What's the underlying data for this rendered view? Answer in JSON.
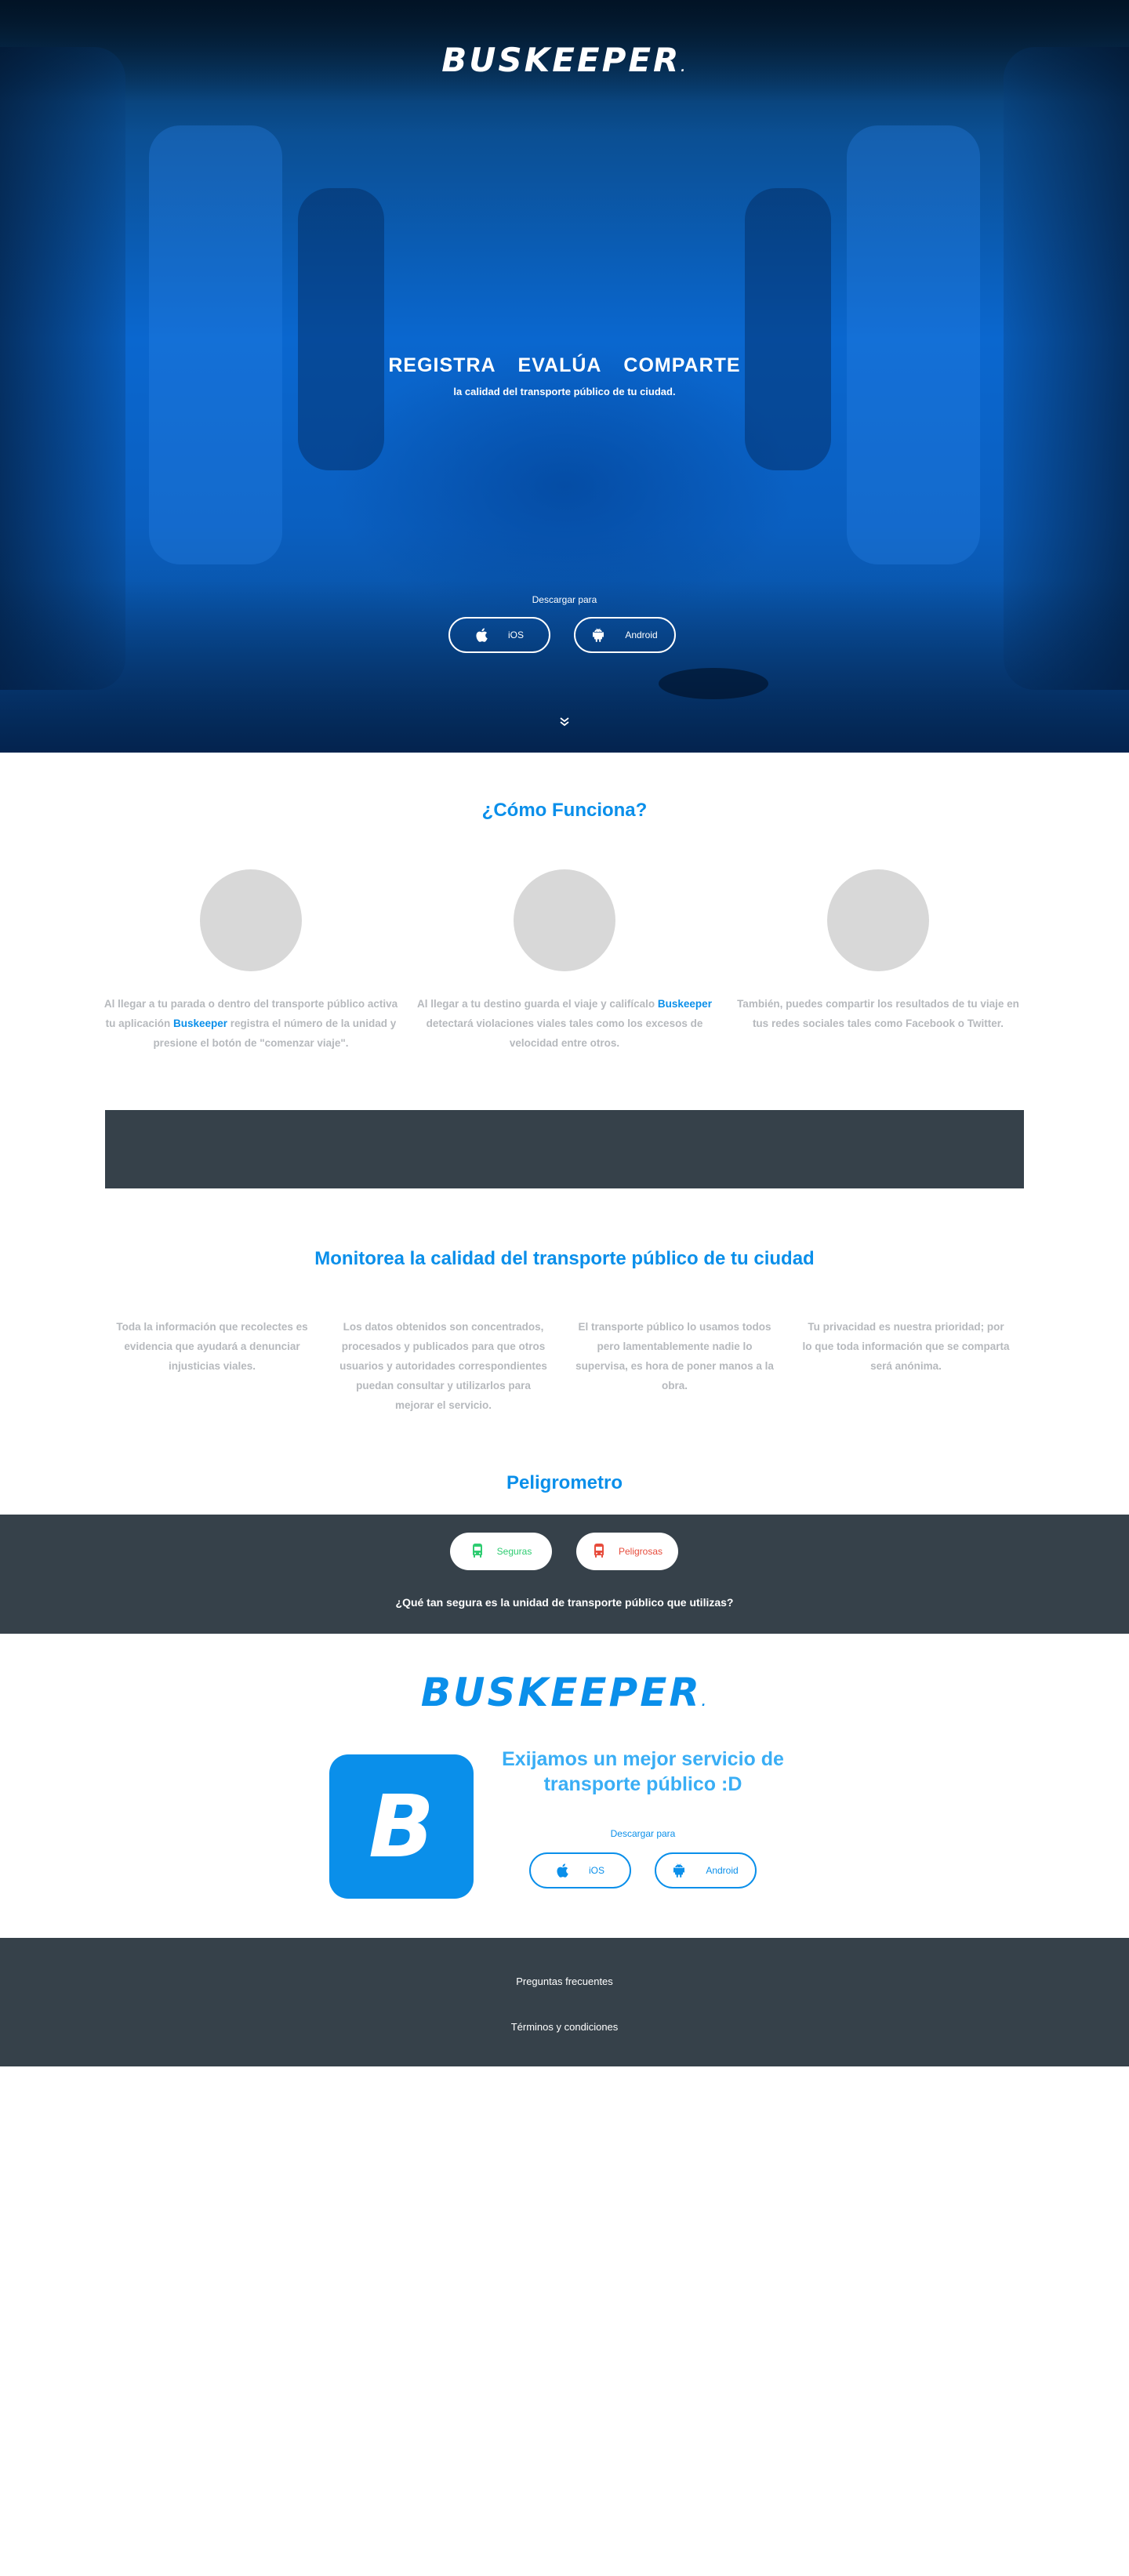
{
  "brand": {
    "name": "BUSKEEPER",
    "mark": "."
  },
  "hero": {
    "words": [
      "REGISTRA",
      "EVALÚA",
      "COMPARTE"
    ],
    "subtitle": "la calidad del transporte público de tu ciudad.",
    "download_label": "Descargar para",
    "buttons": [
      {
        "label": "iOS",
        "icon": "apple-icon"
      },
      {
        "label": "Android",
        "icon": "android-icon"
      }
    ],
    "scroll_icon": "double-chevron-down-icon"
  },
  "how": {
    "title": "¿Cómo Funciona?",
    "steps": [
      {
        "before": "Al llegar a tu parada o dentro del transporte público activa tu aplicación ",
        "link": "Buskeeper",
        "after": " registra el número de la unidad y presione el botón de \"comenzar viaje\"."
      },
      {
        "before": "Al llegar a tu destino guarda el viaje y califícalo ",
        "link": "Buskeeper",
        "after": " detectará violaciones viales tales como los excesos de velocidad entre otros."
      },
      {
        "before": "También, puedes compartir los resultados de tu viaje en tus redes sociales tales como Facebook o Twitter.",
        "link": "",
        "after": ""
      }
    ]
  },
  "monitor": {
    "title": "Monitorea la calidad del transporte público de tu ciudad",
    "items": [
      "Toda la información que recolectes es evidencia que ayudará a denunciar injusticias viales.",
      "Los datos obtenidos son concentrados, procesados y publicados para que otros usuarios y autoridades correspondientes puedan consultar y utilizarlos para mejorar el servicio.",
      "El transporte público lo usamos todos pero lamentablemente nadie lo supervisa, es hora de poner manos a la obra.",
      "Tu privacidad es nuestra prioridad; por lo que toda información que se comparta será anónima."
    ]
  },
  "peligrometro": {
    "title": "Peligrometro",
    "options": [
      {
        "label": "Seguras",
        "icon": "bus-icon",
        "color": "#2ecc71"
      },
      {
        "label": "Peligrosas",
        "icon": "bus-icon",
        "color": "#e74c3c"
      }
    ],
    "question": "¿Qué tan segura es la unidad de transporte público que utilizas?"
  },
  "cta": {
    "app_letter": "B",
    "title": "Exijamos un mejor servicio de transporte público :D",
    "download_label": "Descargar para",
    "buttons": [
      {
        "label": "iOS",
        "icon": "apple-icon"
      },
      {
        "label": "Android",
        "icon": "android-icon"
      }
    ]
  },
  "footer": {
    "links": [
      "Preguntas frecuentes",
      "Términos y condiciones"
    ]
  },
  "colors": {
    "accent": "#0a8fea",
    "dark": "#36414a",
    "muted_text": "#b6b9bd"
  }
}
